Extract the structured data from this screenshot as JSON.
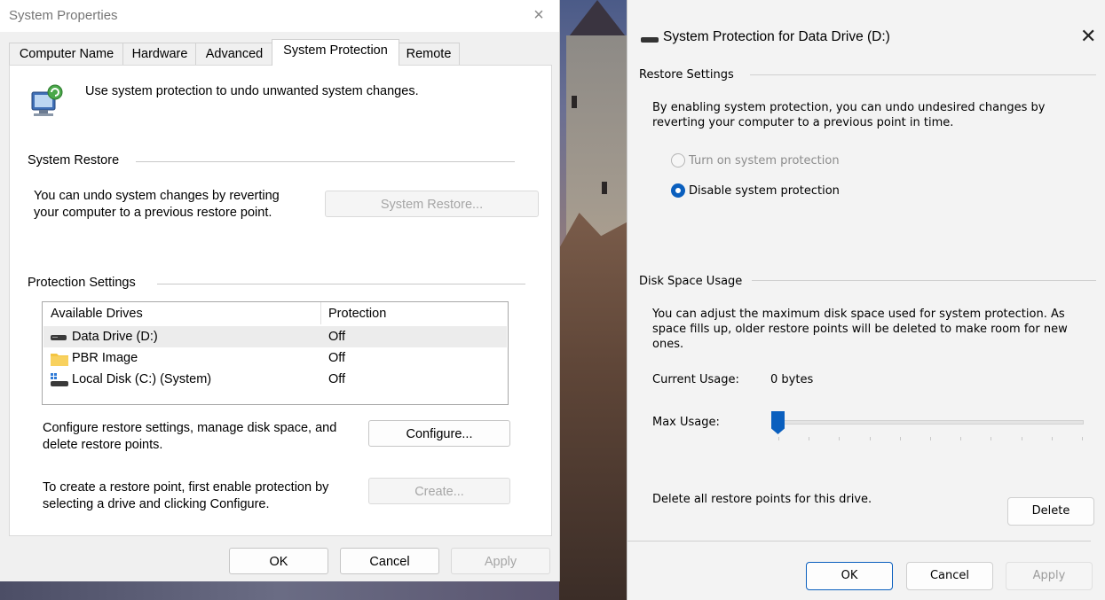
{
  "system_properties": {
    "title": "System Properties",
    "close_glyph": "×",
    "tabs": [
      {
        "label": "Computer Name",
        "active": false
      },
      {
        "label": "Hardware",
        "active": false
      },
      {
        "label": "Advanced",
        "active": false
      },
      {
        "label": "System Protection",
        "active": true
      },
      {
        "label": "Remote",
        "active": false
      }
    ],
    "intro_text": "Use system protection to undo unwanted system changes.",
    "system_restore": {
      "heading": "System Restore",
      "description_line1": "You can undo system changes by reverting",
      "description_line2": "your computer to a previous restore point.",
      "button_label": "System Restore..."
    },
    "protection_settings": {
      "heading": "Protection Settings",
      "columns": [
        "Available Drives",
        "Protection"
      ],
      "drives": [
        {
          "name": "Data Drive (D:)",
          "protection": "Off",
          "icon": "drive-icon",
          "selected": true
        },
        {
          "name": "PBR Image",
          "protection": "Off",
          "icon": "folder-icon",
          "selected": false
        },
        {
          "name": "Local Disk (C:) (System)",
          "protection": "Off",
          "icon": "system-drive-icon",
          "selected": false
        }
      ],
      "configure_text_line1": "Configure restore settings, manage disk space, and",
      "configure_text_line2": "delete restore points.",
      "configure_button": "Configure...",
      "create_text_line1": "To create a restore point, first enable protection by",
      "create_text_line2": "selecting a drive and clicking Configure.",
      "create_button": "Create..."
    },
    "footer": {
      "ok": "OK",
      "cancel": "Cancel",
      "apply": "Apply"
    }
  },
  "protection_dialog": {
    "title": "System Protection for Data Drive (D:)",
    "close_glyph": "✕",
    "restore_settings": {
      "heading": "Restore Settings",
      "description_line1": "By enabling system protection, you can undo undesired changes by",
      "description_line2": "reverting your computer to a previous point in time.",
      "option_on": "Turn on system protection",
      "option_off": "Disable system protection",
      "selected": "Disable system protection"
    },
    "disk_space": {
      "heading": "Disk Space Usage",
      "description_line1": "You can adjust the maximum disk space used for system protection. As",
      "description_line2": "space fills up, older restore points will be deleted to make room for new",
      "description_line3": "ones.",
      "current_usage_label": "Current Usage:",
      "current_usage_value": "0 bytes",
      "max_usage_label": "Max Usage:",
      "max_usage_fraction": 0.0
    },
    "delete_text": "Delete all restore points for this drive.",
    "delete_button": "Delete",
    "footer": {
      "ok": "OK",
      "cancel": "Cancel",
      "apply": "Apply"
    }
  },
  "colors": {
    "accent": "#0a5fbe",
    "dialog_bg": "#f0f0f0",
    "panel_bg": "#ffffff",
    "disabled_text": "#a6a6a6"
  }
}
